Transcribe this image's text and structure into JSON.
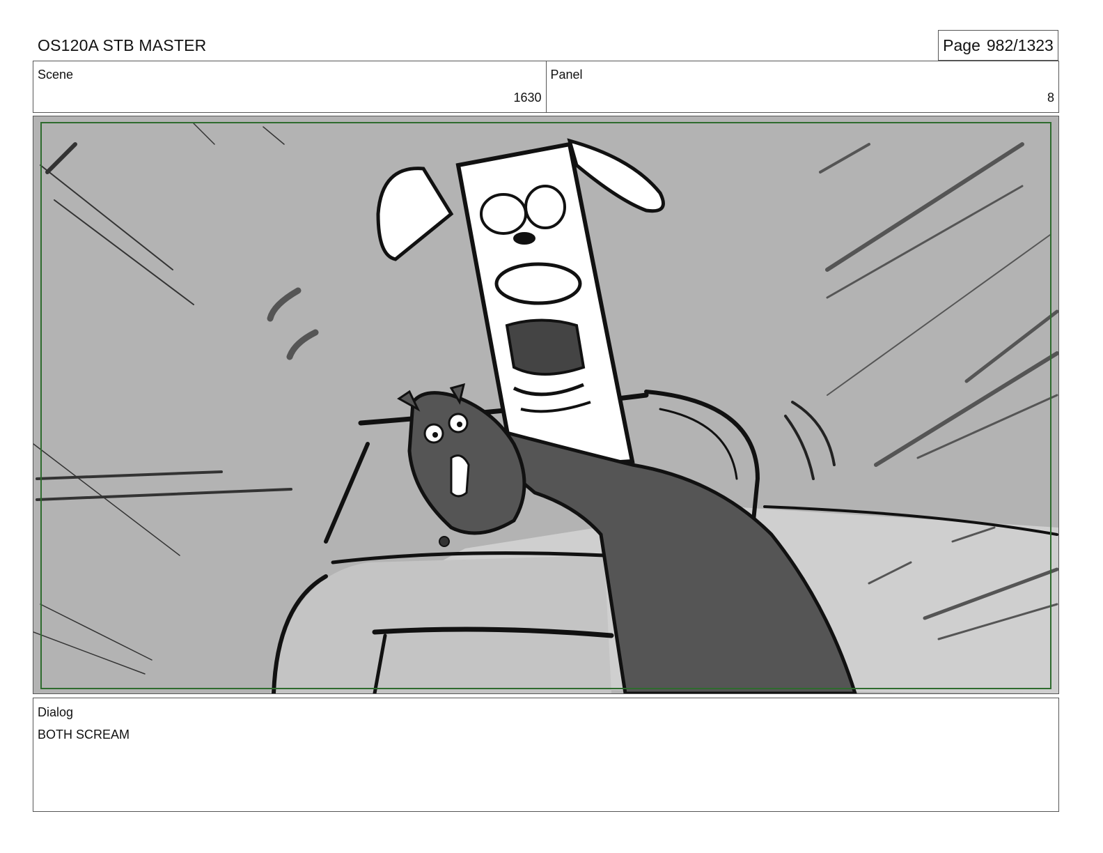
{
  "header": {
    "title": "OS120A STB MASTER",
    "page_label": "Page",
    "page_number": "982/1323"
  },
  "scene": {
    "label": "Scene",
    "value": "1630"
  },
  "panel": {
    "label": "Panel",
    "value": "8"
  },
  "frame": {
    "safe_area_color": "#2e6b2e",
    "background_color": "#b3b3b3",
    "description_icon": "storyboard-sketch"
  },
  "dialog": {
    "label": "Dialog",
    "text": "BOTH SCREAM"
  }
}
